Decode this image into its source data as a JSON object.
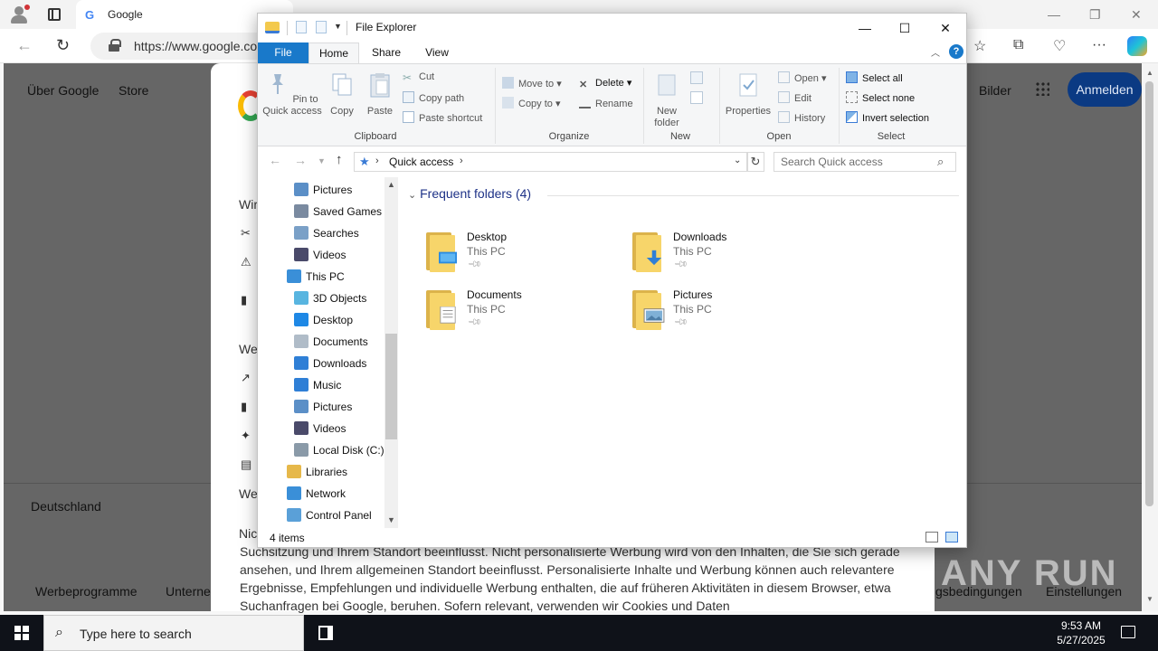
{
  "browser": {
    "tab_title": "Google",
    "address": "https://www.google.co",
    "colors": {
      "accent": "#1979ca"
    }
  },
  "google_page": {
    "top_links": [
      "Über Google",
      "Store"
    ],
    "bilder": "Bilder",
    "anmelden": "Anmelden",
    "country": "Deutschland",
    "footer_left": [
      "Werbeprogramme",
      "Unterne"
    ],
    "footer_right": [
      "gsbedingungen",
      "Einstellungen"
    ],
    "consent_stubs": [
      "Wir",
      "We",
      "We",
      "Nic"
    ],
    "consent_paragraph": "Suchsitzung und Ihrem Standort beeinflusst. Nicht personalisierte Werbung wird von den Inhalten, die Sie sich gerade ansehen, und Ihrem allgemeinen Standort beeinflusst. Personalisierte Inhalte und Werbung können auch relevantere Ergebnisse, Empfehlungen und individuelle Werbung enthalten, die auf früheren Aktivitäten in diesem Browser, etwa Suchanfragen bei Google, beruhen. Sofern relevant, verwenden wir Cookies und Daten"
  },
  "watermark": "ANY RUN",
  "explorer": {
    "title": "File Explorer",
    "tabs": [
      "File",
      "Home",
      "Share",
      "View"
    ],
    "ribbon": {
      "clipboard": {
        "label": "Clipboard",
        "pin": "Pin to Quick access",
        "copy": "Copy",
        "paste": "Paste",
        "cut": "Cut",
        "copy_path": "Copy path",
        "paste_shortcut": "Paste shortcut"
      },
      "organize": {
        "label": "Organize",
        "move_to": "Move to",
        "copy_to": "Copy to",
        "delete": "Delete",
        "rename": "Rename"
      },
      "new": {
        "label": "New",
        "new_folder": "New folder"
      },
      "open": {
        "label": "Open",
        "properties": "Properties",
        "open": "Open",
        "edit": "Edit",
        "history": "History"
      },
      "select": {
        "label": "Select",
        "select_all": "Select all",
        "select_none": "Select none",
        "invert": "Invert selection"
      }
    },
    "address": {
      "location": "Quick access",
      "search_placeholder": "Search Quick access"
    },
    "nav_items": [
      {
        "label": "Pictures",
        "icon": "pictures-icon",
        "indent": 1
      },
      {
        "label": "Saved Games",
        "icon": "saved-games-icon",
        "indent": 1
      },
      {
        "label": "Searches",
        "icon": "searches-icon",
        "indent": 1
      },
      {
        "label": "Videos",
        "icon": "videos-icon",
        "indent": 1
      },
      {
        "label": "This PC",
        "icon": "this-pc-icon",
        "indent": 0
      },
      {
        "label": "3D Objects",
        "icon": "3d-objects-icon",
        "indent": 1
      },
      {
        "label": "Desktop",
        "icon": "desktop-icon",
        "indent": 1
      },
      {
        "label": "Documents",
        "icon": "documents-icon",
        "indent": 1
      },
      {
        "label": "Downloads",
        "icon": "downloads-icon",
        "indent": 1
      },
      {
        "label": "Music",
        "icon": "music-icon",
        "indent": 1
      },
      {
        "label": "Pictures",
        "icon": "pictures-icon",
        "indent": 1
      },
      {
        "label": "Videos",
        "icon": "videos-icon",
        "indent": 1
      },
      {
        "label": "Local Disk (C:)",
        "icon": "local-disk-icon",
        "indent": 1
      },
      {
        "label": "Libraries",
        "icon": "libraries-icon",
        "indent": 0
      },
      {
        "label": "Network",
        "icon": "network-icon",
        "indent": 0
      },
      {
        "label": "Control Panel",
        "icon": "control-panel-icon",
        "indent": 0
      }
    ],
    "group_header": "Frequent folders (4)",
    "folders": [
      {
        "name": "Desktop",
        "location": "This PC",
        "badge": "desktop"
      },
      {
        "name": "Downloads",
        "location": "This PC",
        "badge": "downloads"
      },
      {
        "name": "Documents",
        "location": "This PC",
        "badge": "documents"
      },
      {
        "name": "Pictures",
        "location": "This PC",
        "badge": "pictures"
      }
    ],
    "status": "4 items"
  },
  "taskbar": {
    "search_placeholder": "Type here to search",
    "time": "9:53 AM",
    "date": "5/27/2025"
  }
}
